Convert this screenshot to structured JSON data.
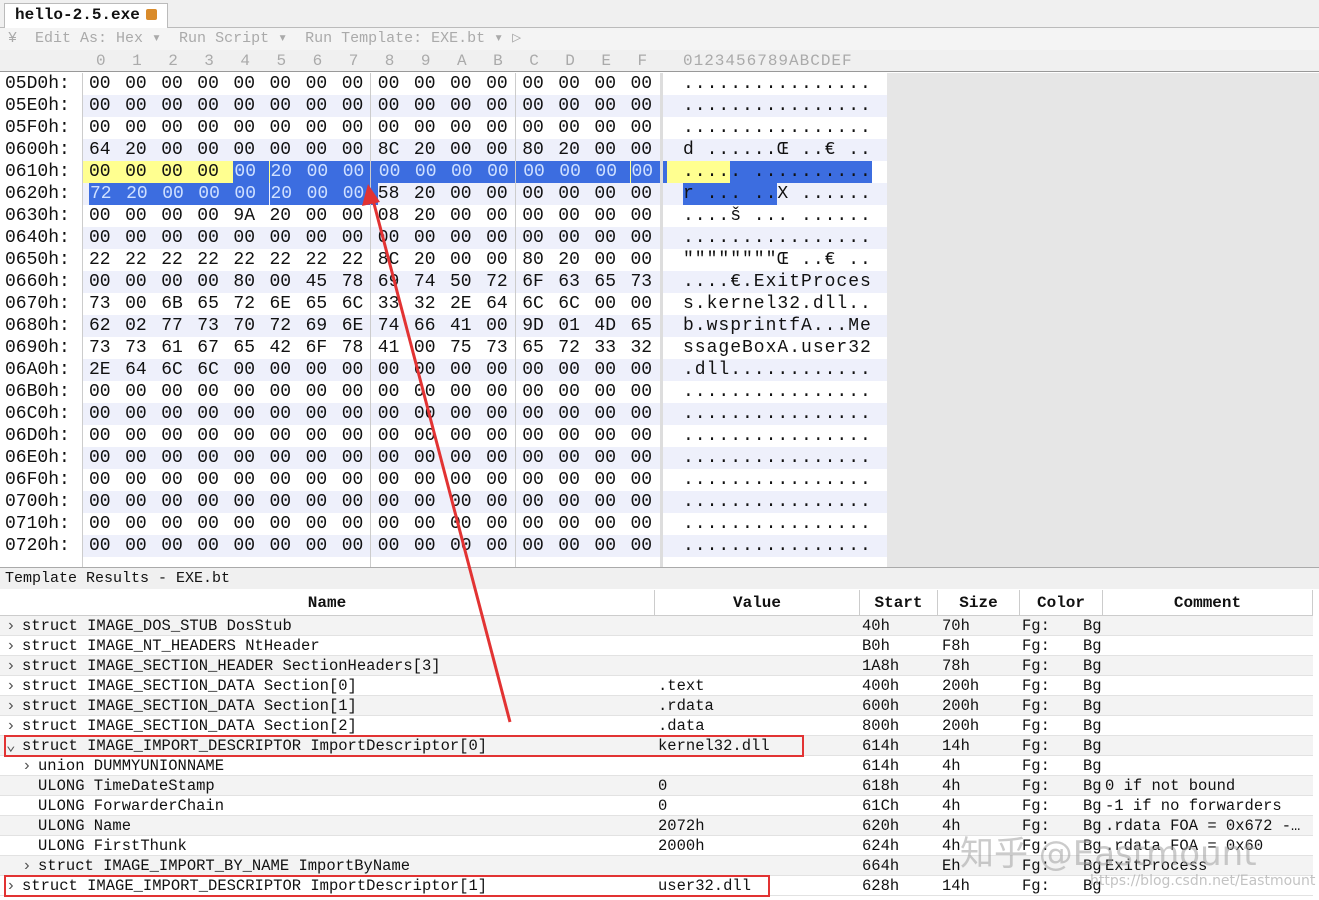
{
  "tab": {
    "title": "hello-2.5.exe",
    "close_icon": "close-icon"
  },
  "toolbar": {
    "text": "¥  Edit As: Hex ▾  Run Script ▾  Run Template: EXE.bt ▾ ▷"
  },
  "hex_header": [
    "0",
    "1",
    "2",
    "3",
    "4",
    "5",
    "6",
    "7",
    "8",
    "9",
    "A",
    "B",
    "C",
    "D",
    "E",
    "F"
  ],
  "ascii_header": "0123456789ABCDEF",
  "hex_rows": [
    {
      "addr": "05D0h:",
      "bytes": "00 00 00 00 00 00 00 00 00 00 00 00 00 00 00 00",
      "ascii": "................"
    },
    {
      "addr": "05E0h:",
      "bytes": "00 00 00 00 00 00 00 00 00 00 00 00 00 00 00 00",
      "ascii": "................"
    },
    {
      "addr": "05F0h:",
      "bytes": "00 00 00 00 00 00 00 00 00 00 00 00 00 00 00 00",
      "ascii": "................"
    },
    {
      "addr": "0600h:",
      "bytes": "64 20 00 00 00 00 00 00 8C 20 00 00 80 20 00 00",
      "ascii": "d ......Œ ..€ .."
    },
    {
      "addr": "0610h:",
      "bytes": "00 00 00 00 00 20 00 00 00 00 00 00 00 00 00 00",
      "ascii": "..... .........."
    },
    {
      "addr": "0620h:",
      "bytes": "72 20 00 00 00 20 00 00 58 20 00 00 00 00 00 00",
      "ascii": "r ... ..X ......"
    },
    {
      "addr": "0630h:",
      "bytes": "00 00 00 00 9A 20 00 00 08 20 00 00 00 00 00 00",
      "ascii": "....š ... ......"
    },
    {
      "addr": "0640h:",
      "bytes": "00 00 00 00 00 00 00 00 00 00 00 00 00 00 00 00",
      "ascii": "................"
    },
    {
      "addr": "0650h:",
      "bytes": "22 22 22 22 22 22 22 22 8C 20 00 00 80 20 00 00",
      "ascii": "\"\"\"\"\"\"\"\"Œ ..€ .."
    },
    {
      "addr": "0660h:",
      "bytes": "00 00 00 00 80 00 45 78 69 74 50 72 6F 63 65 73",
      "ascii": "....€.ExitProces"
    },
    {
      "addr": "0670h:",
      "bytes": "73 00 6B 65 72 6E 65 6C 33 32 2E 64 6C 6C 00 00",
      "ascii": "s.kernel32.dll.."
    },
    {
      "addr": "0680h:",
      "bytes": "62 02 77 73 70 72 69 6E 74 66 41 00 9D 01 4D 65",
      "ascii": "b.wsprintfA...Me"
    },
    {
      "addr": "0690h:",
      "bytes": "73 73 61 67 65 42 6F 78 41 00 75 73 65 72 33 32",
      "ascii": "ssageBoxA.user32"
    },
    {
      "addr": "06A0h:",
      "bytes": "2E 64 6C 6C 00 00 00 00 00 00 00 00 00 00 00 00",
      "ascii": ".dll............"
    },
    {
      "addr": "06B0h:",
      "bytes": "00 00 00 00 00 00 00 00 00 00 00 00 00 00 00 00",
      "ascii": "................"
    },
    {
      "addr": "06C0h:",
      "bytes": "00 00 00 00 00 00 00 00 00 00 00 00 00 00 00 00",
      "ascii": "................"
    },
    {
      "addr": "06D0h:",
      "bytes": "00 00 00 00 00 00 00 00 00 00 00 00 00 00 00 00",
      "ascii": "................"
    },
    {
      "addr": "06E0h:",
      "bytes": "00 00 00 00 00 00 00 00 00 00 00 00 00 00 00 00",
      "ascii": "................"
    },
    {
      "addr": "06F0h:",
      "bytes": "00 00 00 00 00 00 00 00 00 00 00 00 00 00 00 00",
      "ascii": "................"
    },
    {
      "addr": "0700h:",
      "bytes": "00 00 00 00 00 00 00 00 00 00 00 00 00 00 00 00",
      "ascii": "................"
    },
    {
      "addr": "0710h:",
      "bytes": "00 00 00 00 00 00 00 00 00 00 00 00 00 00 00 00",
      "ascii": "................"
    },
    {
      "addr": "0720h:",
      "bytes": "00 00 00 00 00 00 00 00 00 00 00 00 00 00 00 00",
      "ascii": "................"
    }
  ],
  "selection": {
    "start": "614h",
    "end": "627h",
    "cursor_row": "0610h"
  },
  "template": {
    "title": "Template Results - EXE.bt",
    "columns": [
      "Name",
      "Value",
      "Start",
      "Size",
      "Color",
      "Comment"
    ],
    "rows": [
      {
        "indent": 0,
        "arrow": "›",
        "name": "struct IMAGE_DOS_STUB DosStub",
        "value": "",
        "start": "40h",
        "size": "70h",
        "fg": "Fg:",
        "bg": "Bg",
        "comment": ""
      },
      {
        "indent": 0,
        "arrow": "›",
        "name": "struct IMAGE_NT_HEADERS NtHeader",
        "value": "",
        "start": "B0h",
        "size": "F8h",
        "fg": "Fg:",
        "bg": "Bg",
        "comment": ""
      },
      {
        "indent": 0,
        "arrow": "›",
        "name": "struct IMAGE_SECTION_HEADER SectionHeaders[3]",
        "value": "",
        "start": "1A8h",
        "size": "78h",
        "fg": "Fg:",
        "bg": "Bg",
        "comment": ""
      },
      {
        "indent": 0,
        "arrow": "›",
        "name": "struct IMAGE_SECTION_DATA Section[0]",
        "value": ".text",
        "start": "400h",
        "size": "200h",
        "fg": "Fg:",
        "bg": "Bg",
        "comment": ""
      },
      {
        "indent": 0,
        "arrow": "›",
        "name": "struct IMAGE_SECTION_DATA Section[1]",
        "value": ".rdata",
        "start": "600h",
        "size": "200h",
        "fg": "Fg:",
        "bg": "Bg",
        "comment": ""
      },
      {
        "indent": 0,
        "arrow": "›",
        "name": "struct IMAGE_SECTION_DATA Section[2]",
        "value": ".data",
        "start": "800h",
        "size": "200h",
        "fg": "Fg:",
        "bg": "Bg",
        "comment": ""
      },
      {
        "indent": 0,
        "arrow": "⌄",
        "name": "struct IMAGE_IMPORT_DESCRIPTOR ImportDescriptor[0]",
        "value": "kernel32.dll",
        "start": "614h",
        "size": "14h",
        "fg": "Fg:",
        "bg": "Bg",
        "comment": ""
      },
      {
        "indent": 1,
        "arrow": "›",
        "name": "union DUMMYUNIONNAME",
        "value": "",
        "start": "614h",
        "size": "4h",
        "fg": "Fg:",
        "bg": "Bg",
        "comment": ""
      },
      {
        "indent": 1,
        "arrow": "",
        "name": "ULONG TimeDateStamp",
        "value": "0",
        "start": "618h",
        "size": "4h",
        "fg": "Fg:",
        "bg": "Bg",
        "comment": "0 if not bound"
      },
      {
        "indent": 1,
        "arrow": "",
        "name": "ULONG ForwarderChain",
        "value": "0",
        "start": "61Ch",
        "size": "4h",
        "fg": "Fg:",
        "bg": "Bg",
        "comment": "-1 if no forwarders"
      },
      {
        "indent": 1,
        "arrow": "",
        "name": "ULONG Name",
        "value": "2072h",
        "start": "620h",
        "size": "4h",
        "fg": "Fg:",
        "bg": "Bg",
        "comment": ".rdata FOA = 0x672 -…"
      },
      {
        "indent": 1,
        "arrow": "",
        "name": "ULONG FirstThunk",
        "value": "2000h",
        "start": "624h",
        "size": "4h",
        "fg": "Fg:",
        "bg": "Bg",
        "comment": ".rdata FOA = 0x60"
      },
      {
        "indent": 1,
        "arrow": "›",
        "name": "struct IMAGE_IMPORT_BY_NAME ImportByName",
        "value": "",
        "start": "664h",
        "size": "Eh",
        "fg": "Fg:",
        "bg": "Bg",
        "comment": "ExitProcess"
      },
      {
        "indent": 0,
        "arrow": "›",
        "name": "struct IMAGE_IMPORT_DESCRIPTOR ImportDescriptor[1]",
        "value": "user32.dll",
        "start": "628h",
        "size": "14h",
        "fg": "Fg:",
        "bg": "Bg",
        "comment": ""
      }
    ]
  },
  "colors": {
    "selection": "#3c6de0",
    "cursor_row": "#ffff90",
    "annotation": "#e23333"
  },
  "watermark": {
    "text": "知乎 @Eastmount",
    "url": "https://blog.csdn.net/Eastmount"
  }
}
